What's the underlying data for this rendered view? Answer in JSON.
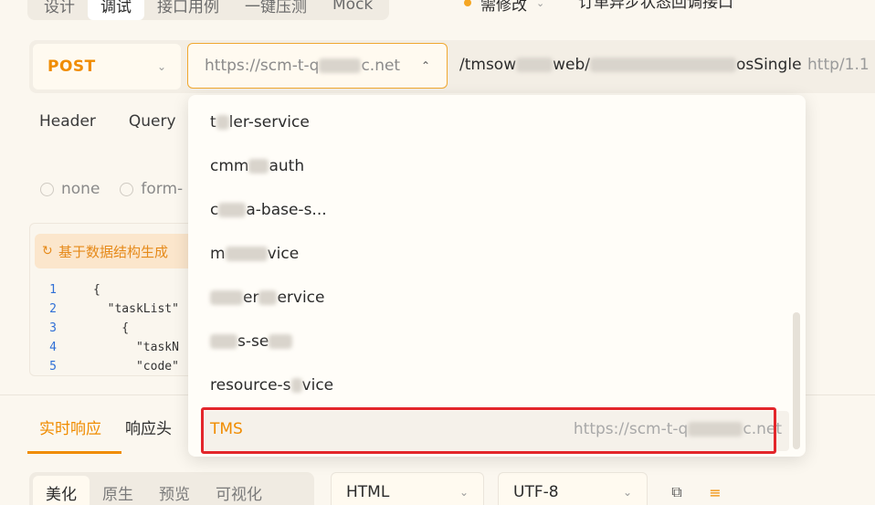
{
  "top_tabs": [
    "设计",
    "调试",
    "接口用例",
    "一键压测",
    "Mock"
  ],
  "top_tab_active": 1,
  "status_label": "需修改",
  "api_title": "订单异步状态回调接口",
  "request": {
    "method": "POST",
    "env_value": "https://scm-t-q",
    "env_value_tail": "c.net",
    "path_prefix": "/tmsow",
    "path_mid": "web/",
    "path_suffix": "osSingle",
    "protocol": "http/1.1"
  },
  "section_tabs": [
    "Header",
    "Query"
  ],
  "body_types": [
    "none",
    "form-"
  ],
  "generate_button": "基于数据结构生成",
  "code_lines": [
    {
      "no": "1",
      "text": "{"
    },
    {
      "no": "2",
      "text": "  \"taskList\""
    },
    {
      "no": "3",
      "text": "    {"
    },
    {
      "no": "4",
      "text": "      \"taskN"
    },
    {
      "no": "5",
      "text": "      \"code\""
    }
  ],
  "dropdown": {
    "options": [
      {
        "a": "t",
        "b": "ler-service"
      },
      {
        "a": "c",
        "b": "auth",
        "mid": "mm"
      },
      {
        "a": "c",
        "b": "a-base-s...",
        "mid": ""
      },
      {
        "a": "m",
        "b": "vice",
        "mid": ""
      },
      {
        "a": "",
        "b": "ervice",
        "mid": "er"
      },
      {
        "a": "",
        "b": "s-se",
        "mid": ""
      },
      {
        "a": "resource-s",
        "b": "vice",
        "mid": ""
      }
    ],
    "selected": {
      "name": "TMS",
      "url_prefix": "https://scm-t-q",
      "url_suffix": "c.net"
    }
  },
  "response_tabs": [
    "实时响应",
    "响应头"
  ],
  "response_tab_active": 0,
  "view_tabs": [
    "美化",
    "原生",
    "预览",
    "可视化"
  ],
  "view_tab_active": 0,
  "format_select": "HTML",
  "encoding_select": "UTF-8",
  "colors": {
    "accent": "#f08c00",
    "highlight": "#e3262b"
  }
}
